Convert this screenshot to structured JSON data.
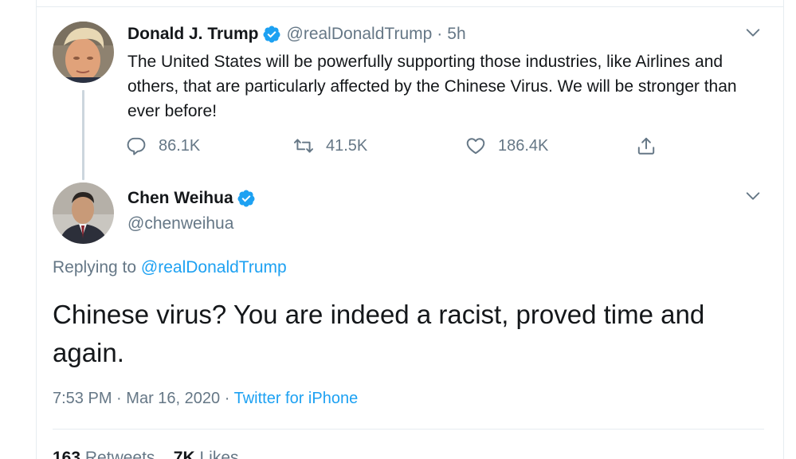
{
  "parent_tweet": {
    "display_name": "Donald J. Trump",
    "handle": "@realDonaldTrump",
    "separator": "·",
    "time": "5h",
    "text": "The United States will be powerfully supporting those industries, like Airlines and others, that are particularly affected by the Chinese Virus. We will be stronger than ever before!",
    "actions": {
      "replies": "86.1K",
      "retweets": "41.5K",
      "likes": "186.4K"
    },
    "icons": [
      "verified-badge-icon",
      "chevron-down-icon",
      "reply-icon",
      "retweet-icon",
      "like-icon",
      "share-icon"
    ]
  },
  "main_tweet": {
    "display_name": "Chen Weihua",
    "handle": "@chenweihua",
    "replying_label": "Replying to",
    "replying_handle": "@realDonaldTrump",
    "text": "Chinese virus? You are indeed a racist, proved time and again.",
    "time": "7:53 PM",
    "separator": "·",
    "date": "Mar 16, 2020",
    "source": "Twitter for iPhone",
    "stats": {
      "retweets_count": "163",
      "retweets_label": "Retweets",
      "likes_count": "7K",
      "likes_label": "Likes"
    }
  },
  "colors": {
    "accent": "#1da1f2",
    "secondary_text": "#657786",
    "primary_text": "#14171a",
    "border": "#e6ecf0",
    "thread_line": "#ccd6dd"
  }
}
